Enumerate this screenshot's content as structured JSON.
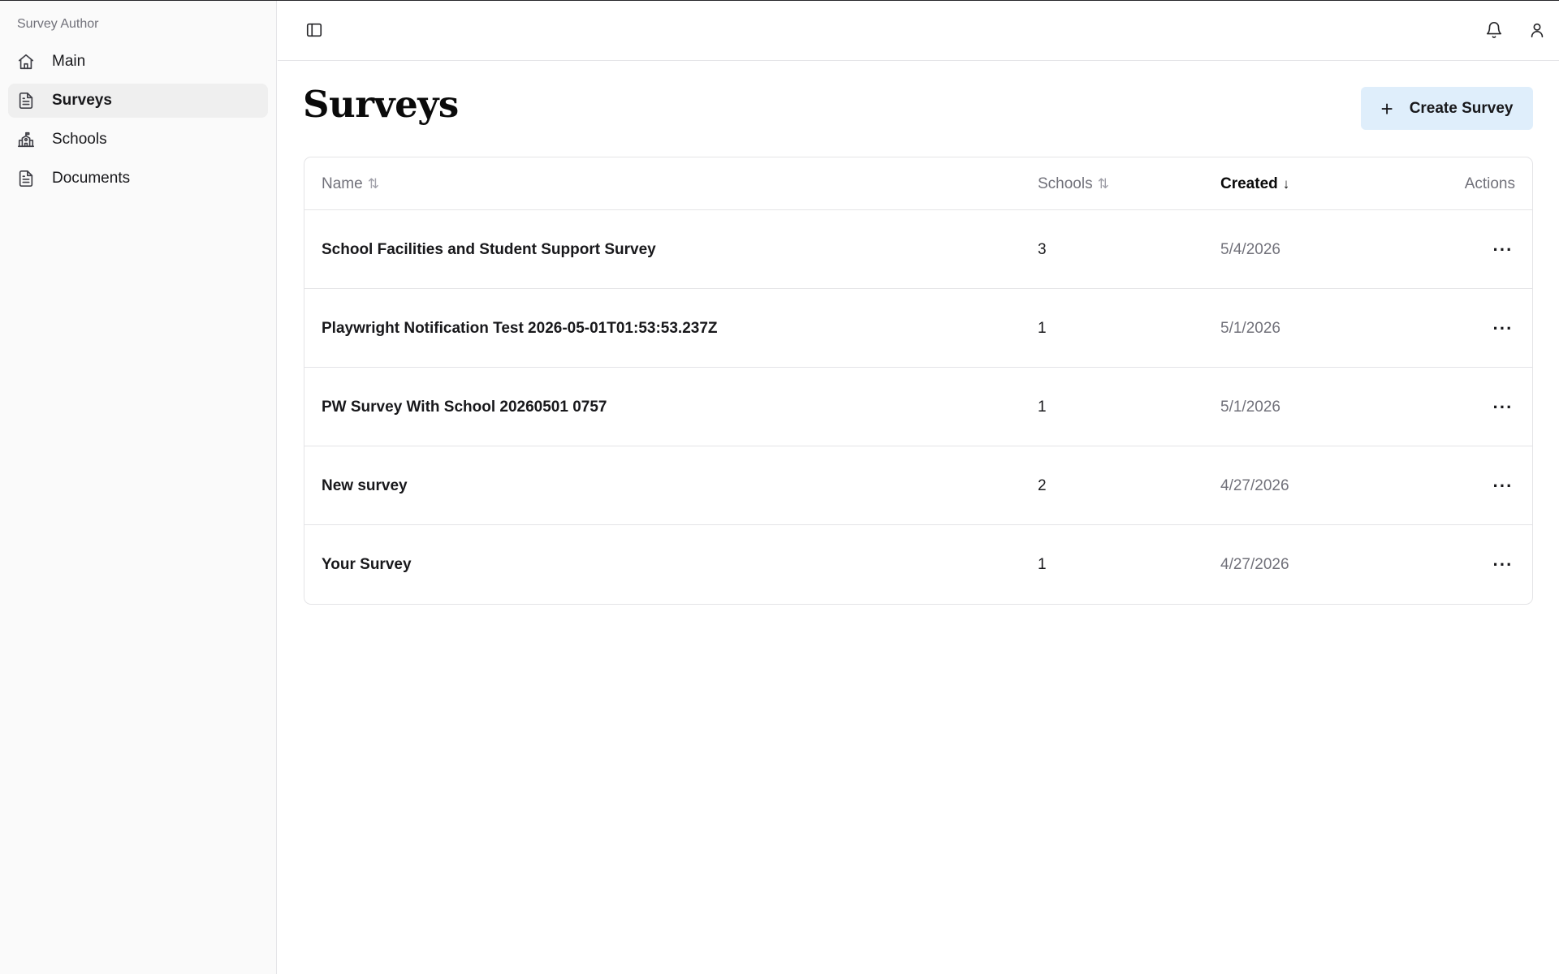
{
  "sidebar": {
    "brand": "Survey Author",
    "items": [
      {
        "label": "Main",
        "icon": "home-icon"
      },
      {
        "label": "Surveys",
        "icon": "file-text-icon",
        "active": true
      },
      {
        "label": "Schools",
        "icon": "school-icon"
      },
      {
        "label": "Documents",
        "icon": "file-text-icon"
      }
    ]
  },
  "topbar": {
    "toggle_icon": "sidebar-toggle-icon",
    "notification_icon": "bell-icon",
    "user_icon": "user-icon"
  },
  "main": {
    "title": "Surveys",
    "create_button": {
      "icon": "plus-icon",
      "label": "Create Survey"
    },
    "table": {
      "columns": [
        {
          "label": "Name",
          "sort_icon": "⇅",
          "active": false
        },
        {
          "label": "Schools",
          "sort_icon": "⇅",
          "active": false
        },
        {
          "label": "Created",
          "sort_icon": "↓",
          "active": true
        },
        {
          "label": "Actions"
        }
      ],
      "rows": [
        {
          "name": "School Facilities and Student Support Survey",
          "schools": "3",
          "created": "5/4/2026",
          "actions": "···"
        },
        {
          "name": "Playwright Notification Test 2026-05-01T01:53:53.237Z",
          "schools": "1",
          "created": "5/1/2026",
          "actions": "···"
        },
        {
          "name": "PW Survey With School 20260501 0757",
          "schools": "1",
          "created": "5/1/2026",
          "actions": "···"
        },
        {
          "name": "New survey",
          "schools": "2",
          "created": "4/27/2026",
          "actions": "···"
        },
        {
          "name": "Your Survey",
          "schools": "1",
          "created": "4/27/2026",
          "actions": "···"
        }
      ]
    }
  },
  "colors": {
    "sidebar_bg": "#fafafa",
    "active_nav_bg": "#efefef",
    "create_button_bg": "#dfeefb",
    "muted_text": "#71717a",
    "border": "#e4e4e7"
  }
}
